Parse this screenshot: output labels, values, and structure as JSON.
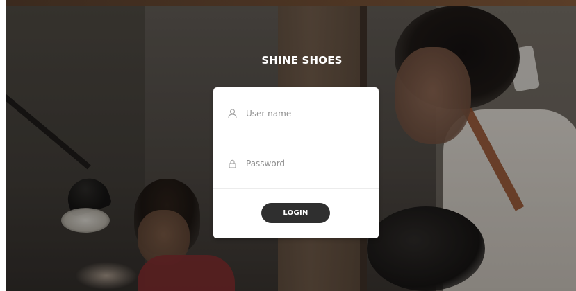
{
  "brand": {
    "title": "SHINE SHOES"
  },
  "login_form": {
    "username": {
      "placeholder": "User name",
      "value": "",
      "icon": "user-icon"
    },
    "password": {
      "placeholder": "Password",
      "value": "",
      "icon": "lock-icon"
    },
    "submit_label": "LOGIN"
  },
  "colors": {
    "button_bg": "#2f2f2f",
    "card_bg": "#ffffff",
    "brand_text": "#ffffff",
    "placeholder_text": "#8e8e8e"
  }
}
